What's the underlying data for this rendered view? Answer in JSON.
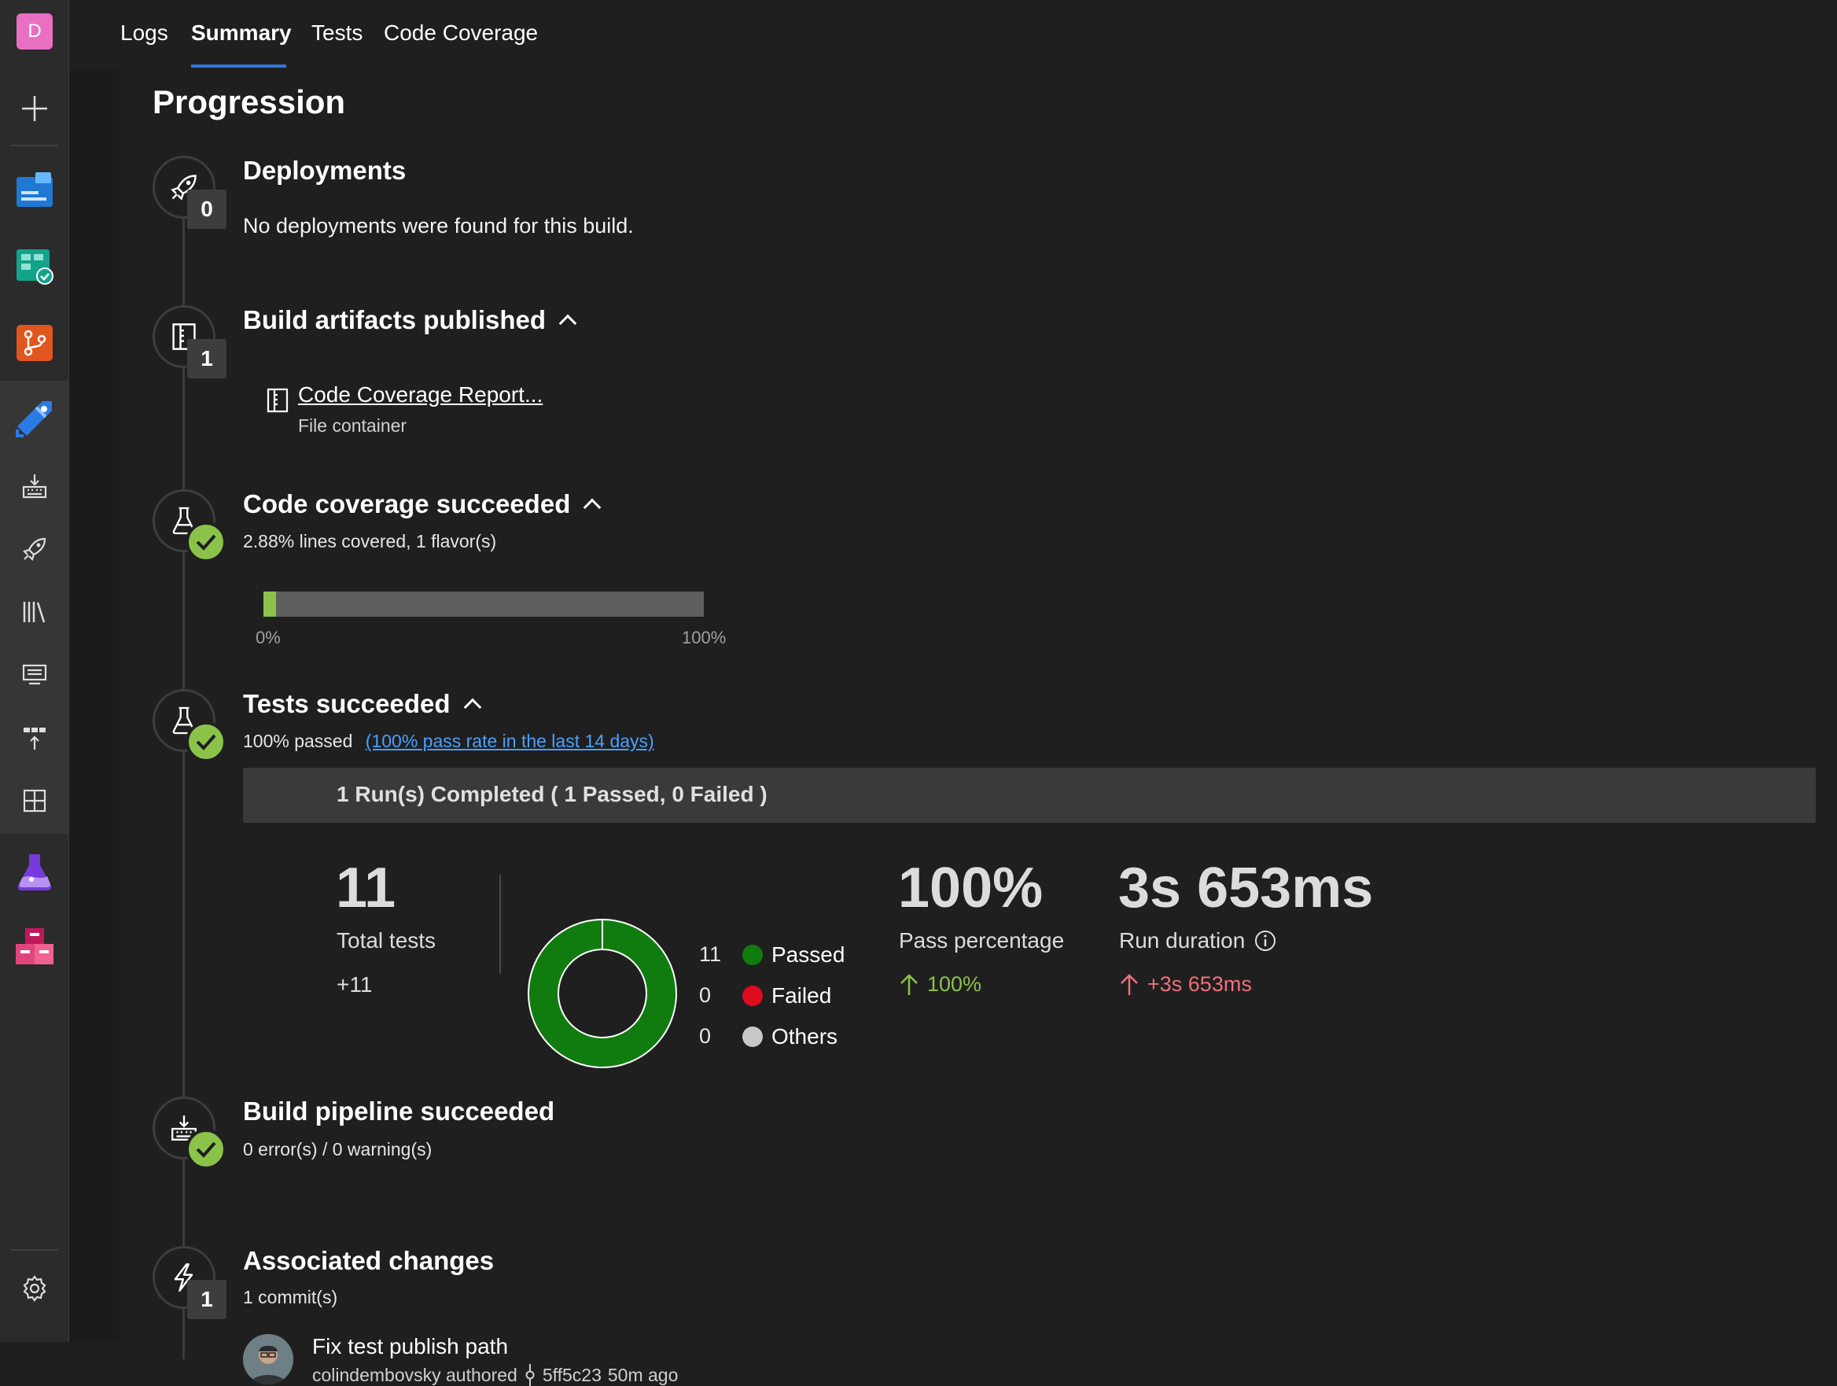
{
  "rail": {
    "avatar_letter": "D",
    "items": [
      "avatar",
      "add",
      "overview",
      "boards",
      "repos",
      "pipelines",
      "builds",
      "releases",
      "library",
      "task-groups",
      "deployment-groups",
      "xaml",
      "test-plans",
      "artifacts",
      "settings"
    ]
  },
  "tabs": [
    {
      "label": "Logs"
    },
    {
      "label": "Summary"
    },
    {
      "label": "Tests"
    },
    {
      "label": "Code Coverage"
    }
  ],
  "main": {
    "title": "Progression",
    "deployments": {
      "title": "Deployments",
      "badge": "0",
      "message": "No deployments were found for this build."
    },
    "artifacts": {
      "title": "Build artifacts published",
      "badge": "1",
      "item_name": "Code Coverage Report...",
      "item_type": "File container"
    },
    "coverage": {
      "title": "Code coverage succeeded",
      "subtitle": "2.88% lines covered, 1 flavor(s)",
      "percent": 2.88,
      "axis_min": "0%",
      "axis_max": "100%"
    },
    "tests": {
      "title": "Tests succeeded",
      "passed_text": "100% passed",
      "pass_rate_link": "(100% pass rate in the last 14 days)",
      "run_summary": "1 Run(s) Completed ( 1 Passed, 0 Failed )",
      "total": "11",
      "total_label": "Total tests",
      "total_delta": "+11",
      "legend": [
        {
          "count": "11",
          "label": "Passed",
          "color": "#107c10"
        },
        {
          "count": "0",
          "label": "Failed",
          "color": "#e00b1c"
        },
        {
          "count": "0",
          "label": "Others",
          "color": "#c8c8c8"
        }
      ],
      "pass_pct": "100%",
      "pass_pct_label": "Pass percentage",
      "pass_pct_delta": "100%",
      "duration": "3s 653ms",
      "duration_label": "Run duration",
      "duration_delta": "+3s 653ms"
    },
    "pipeline": {
      "title": "Build pipeline succeeded",
      "subtitle": "0 error(s) / 0 warning(s)"
    },
    "changes": {
      "title": "Associated changes",
      "badge": "1",
      "subtitle": "1 commit(s)",
      "commit_message": "Fix test publish path",
      "commit_author": "colindembovsky authored",
      "commit_hash": "5ff5c23",
      "commit_time": "50m ago"
    }
  },
  "colors": {
    "accent": "#2f7bd9",
    "success": "#8bc34a",
    "passed": "#107c10",
    "failed": "#e00b1c",
    "negative_delta": "#f1707b"
  }
}
